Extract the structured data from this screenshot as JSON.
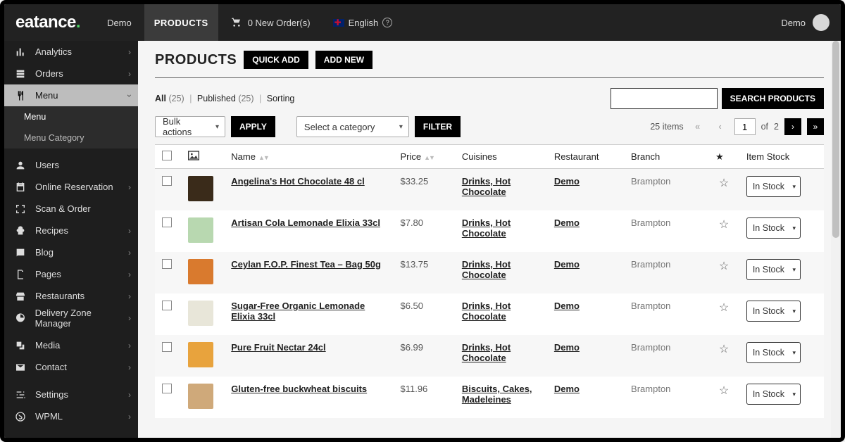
{
  "brand": "eatance",
  "topbar": {
    "demo": "Demo",
    "products": "PRODUCTS",
    "new_orders": "0 New Order(s)",
    "language": "English",
    "user": "Demo"
  },
  "sidebar": {
    "items": [
      {
        "label": "Analytics"
      },
      {
        "label": "Orders"
      },
      {
        "label": "Menu",
        "active": true,
        "children": [
          "Menu",
          "Menu Category"
        ]
      },
      {
        "label": "Users"
      },
      {
        "label": "Online Reservation"
      },
      {
        "label": "Scan & Order"
      },
      {
        "label": "Recipes"
      },
      {
        "label": "Blog"
      },
      {
        "label": "Pages"
      },
      {
        "label": "Restaurants"
      },
      {
        "label": "Delivery Zone Manager"
      },
      {
        "label": "Media"
      },
      {
        "label": "Contact"
      },
      {
        "label": "Settings"
      },
      {
        "label": "WPML"
      }
    ]
  },
  "page": {
    "title": "PRODUCTS",
    "quick_add": "QUICK ADD",
    "add_new": "ADD NEW"
  },
  "views": {
    "all_label": "All",
    "all_count": "(25)",
    "published_label": "Published",
    "published_count": "(25)",
    "sorting_label": "Sorting"
  },
  "search": {
    "placeholder": "",
    "button": "SEARCH PRODUCTS"
  },
  "filters": {
    "bulk_label": "Bulk actions",
    "apply": "APPLY",
    "category_label": "Select a category",
    "filter": "FILTER"
  },
  "pager": {
    "count": "25 items",
    "page_value": "1",
    "of_label": "of",
    "total_pages": "2"
  },
  "columns": {
    "name": "Name",
    "price": "Price",
    "cuisines": "Cuisines",
    "restaurant": "Restaurant",
    "branch": "Branch",
    "item_stock": "Item Stock"
  },
  "stock_option": "In Stock",
  "rows": [
    {
      "name": "Angelina's Hot Chocolate 48 cl",
      "price": "$33.25",
      "cuisines": "Drinks, Hot Chocolate",
      "restaurant": "Demo",
      "branch": "Brampton"
    },
    {
      "name": "Artisan Cola Lemonade Elixia 33cl",
      "price": "$7.80",
      "cuisines": "Drinks, Hot Chocolate",
      "restaurant": "Demo",
      "branch": "Brampton"
    },
    {
      "name": "Ceylan F.O.P. Finest Tea – Bag 50g",
      "price": "$13.75",
      "cuisines": "Drinks, Hot Chocolate",
      "restaurant": "Demo",
      "branch": "Brampton"
    },
    {
      "name": "Sugar-Free Organic Lemonade Elixia 33cl",
      "price": "$6.50",
      "cuisines": "Drinks, Hot Chocolate",
      "restaurant": "Demo",
      "branch": "Brampton"
    },
    {
      "name": "Pure Fruit Nectar 24cl",
      "price": "$6.99",
      "cuisines": "Drinks, Hot Chocolate",
      "restaurant": "Demo",
      "branch": "Brampton"
    },
    {
      "name": "Gluten-free buckwheat biscuits",
      "price": "$11.96",
      "cuisines": "Biscuits, Cakes, Madeleines",
      "restaurant": "Demo",
      "branch": "Brampton"
    }
  ],
  "thumb_colors": [
    "#3a2b1a",
    "#b8d8b0",
    "#d97a2e",
    "#e8e6d9",
    "#e8a33d",
    "#cfa97a"
  ]
}
